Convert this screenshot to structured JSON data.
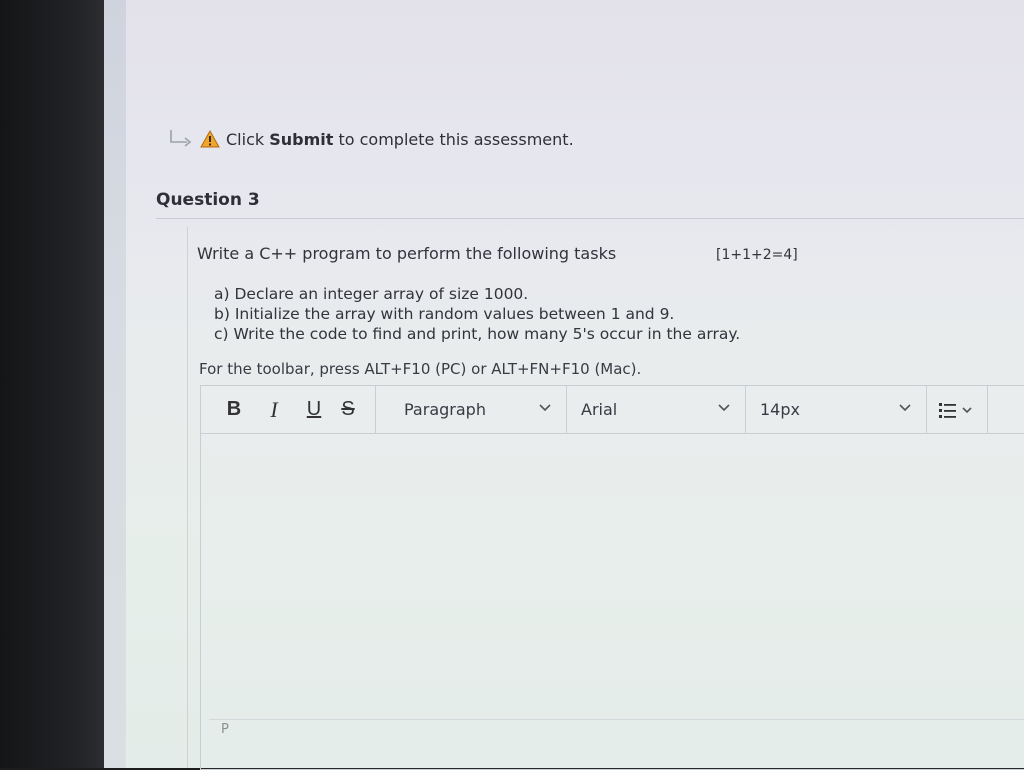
{
  "notice": {
    "prefix": "Click ",
    "action": "Submit",
    "suffix": " to complete this assessment."
  },
  "question": {
    "title": "Question 3",
    "prompt": "Write a C++ program to perform the following tasks",
    "marks": "[1+1+2=4]",
    "tasks": [
      "a) Declare an integer array of size 1000.",
      "b) Initialize the array with random values between 1 and 9.",
      "c) Write the code to find and print, how many 5's occur in the array."
    ]
  },
  "editor": {
    "toolbar_hint": "For the toolbar, press ALT+F10 (PC) or ALT+FN+F10 (Mac).",
    "bold": "B",
    "italic": "I",
    "underline": "U",
    "strikethrough": "S",
    "format_select": "Paragraph",
    "font_select": "Arial",
    "size_select": "14px",
    "status_path": "P"
  },
  "icons": {
    "warning_color": "#f0a62c",
    "arrow": "return-arrow-icon"
  }
}
